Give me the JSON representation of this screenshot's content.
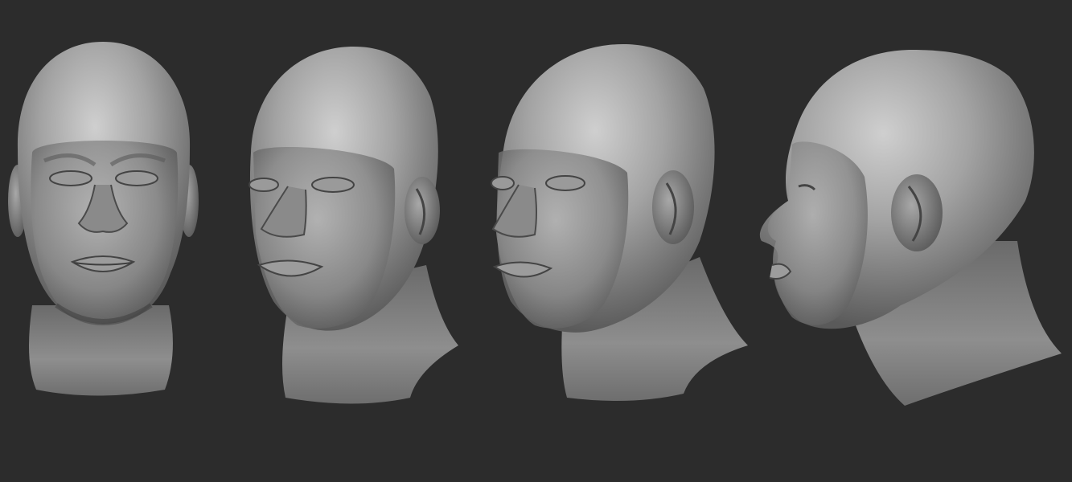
{
  "scene": {
    "background_color": "#2c2c2c",
    "clay_color": "#8c8c8c",
    "clay_highlight": "#c9c9c9",
    "clay_shadow": "#4a4a4a"
  },
  "views": [
    {
      "view": "front"
    },
    {
      "view": "three-quarter-left"
    },
    {
      "view": "three-quarter-left-deep"
    },
    {
      "view": "profile-left"
    }
  ]
}
